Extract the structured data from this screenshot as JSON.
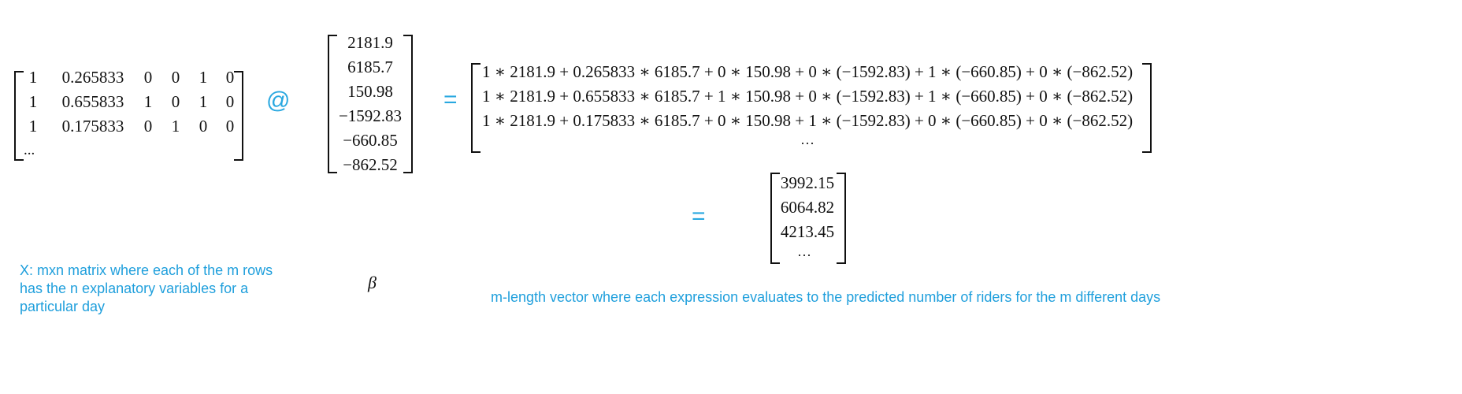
{
  "x_matrix": {
    "rows": [
      [
        "1",
        "0.265833",
        "0",
        "0",
        "1",
        "0"
      ],
      [
        "1",
        "0.655833",
        "1",
        "0",
        "1",
        "0"
      ],
      [
        "1",
        "0.175833",
        "0",
        "1",
        "0",
        "0"
      ]
    ],
    "ellipsis": "..."
  },
  "matmul_operator": "@",
  "beta_vector": [
    "2181.9",
    "6185.7",
    "150.98",
    "−1592.83",
    "−660.85",
    "−862.52"
  ],
  "equals_symbol": "=",
  "expanded_rows": [
    "1 ∗ 2181.9 + 0.265833 ∗ 6185.7 + 0 ∗ 150.98 + 0 ∗ (−1592.83) + 1 ∗ (−660.85) + 0 ∗ (−862.52)",
    "1 ∗ 2181.9 + 0.655833 ∗ 6185.7 + 1 ∗ 150.98 + 0 ∗ (−1592.83) + 1 ∗ (−660.85) + 0 ∗ (−862.52)",
    "1 ∗ 2181.9 + 0.175833 ∗ 6185.7 + 0 ∗ 150.98 + 1 ∗ (−1592.83) + 0 ∗ (−660.85) + 0 ∗ (−862.52)"
  ],
  "expanded_ellipsis": "···",
  "result_vector": [
    "3992.15",
    "6064.82",
    "4213.45"
  ],
  "result_ellipsis": "···",
  "beta_label": "β",
  "x_caption_lines": [
    "X: mxn matrix where each of the m rows",
    "has the n explanatory variables for a",
    "particular day"
  ],
  "result_caption": "m-length vector where each expression evaluates to the predicted number of riders for the m different days",
  "colors": {
    "accent": "#29a8e0",
    "ink": "#111111"
  }
}
